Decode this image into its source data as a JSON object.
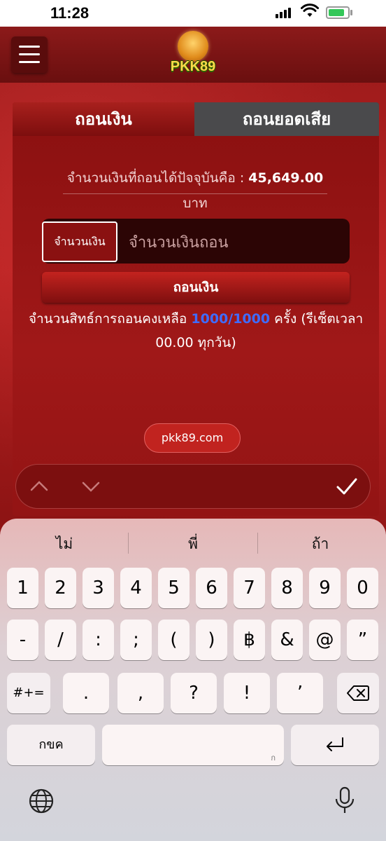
{
  "status_bar": {
    "time": "11:28"
  },
  "header": {
    "menu_icon": "hamburger-icon",
    "logo_text": "PKK89"
  },
  "tabs": [
    {
      "label": "ถอนเงิน",
      "active": true
    },
    {
      "label": "ถอนยอดเสีย",
      "active": false
    }
  ],
  "balance": {
    "label": "จำนวนเงินที่ถอนได้ปัจจุบันคือ :",
    "amount": "45,649.00",
    "currency": "บาท"
  },
  "amount_field": {
    "label": "จำนวนเงิน",
    "placeholder": "จำนวนเงินถอน",
    "value": ""
  },
  "withdraw_button": {
    "label": "ถอนเงิน"
  },
  "quota": {
    "prefix": "จำนวนสิทธ์การถอนคงเหลือ",
    "count": "1000/1000",
    "suffix_line1": "ครั้ง (รีเซ็ตเวลา",
    "suffix_line2": "00.00 ทุกวัน)"
  },
  "site_link": {
    "label": "pkk89.com"
  },
  "keyboard": {
    "suggestions": [
      "ไม่",
      "พี่",
      "ถ้า"
    ],
    "row1": [
      "1",
      "2",
      "3",
      "4",
      "5",
      "6",
      "7",
      "8",
      "9",
      "0"
    ],
    "row2": [
      "-",
      "/",
      ":",
      ";",
      "(",
      ")",
      "฿",
      "&",
      "@",
      "”"
    ],
    "row3_mode": "#+=",
    "row3": [
      ".",
      ",",
      "?",
      "!",
      "’"
    ],
    "mode_key": "กขค",
    "space_hint": "ก"
  },
  "colors": {
    "accent_red": "#a01818",
    "link_blue": "#3f6cff",
    "logo_yellow": "#ffd84a"
  }
}
